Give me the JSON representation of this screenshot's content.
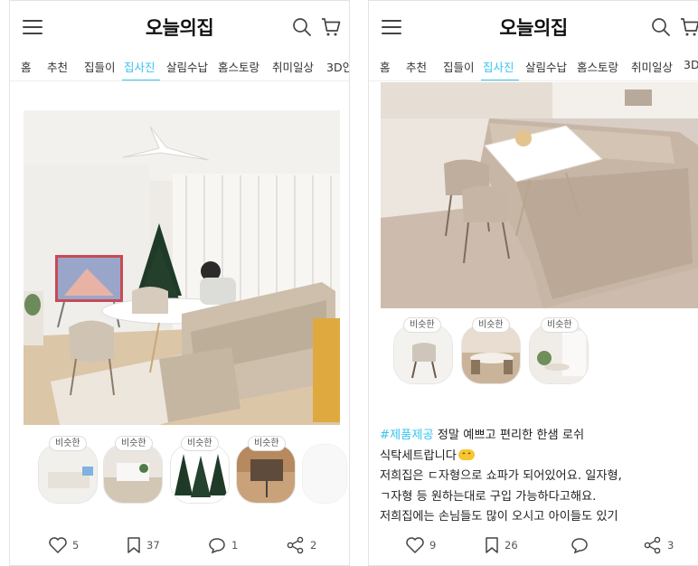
{
  "app": {
    "logo": "오늘의집"
  },
  "tabs": [
    "홈",
    "추천",
    "집들이",
    "집사진",
    "살림수납",
    "홈스토랑",
    "취미일상",
    "3D인"
  ],
  "tabs_right": [
    "홈",
    "추천",
    "집들이",
    "집사진",
    "살림수납",
    "홈스토랑",
    "취미일상",
    "3D"
  ],
  "active_tab": "집사진",
  "similar_badge": "비슷한",
  "left_post": {
    "likes": "5",
    "bookmarks": "37",
    "comments": "1",
    "shares": "2"
  },
  "right_post": {
    "caption_hashtag": "#제품제공",
    "caption_line1_rest": " 정말 예쁘고 편리한 한샘 로쉬",
    "caption_line2": "식탁세트랍니다",
    "caption_line3": "저희집은 ㄷ자형으로 쇼파가 되어있어요. 일자형,",
    "caption_line4": "ㄱ자형 등 원하는대로 구입 가능하다고해요.",
    "caption_line5": "저희집에는 손님들도 많이 오시고 아이들도 있기",
    "likes": "9",
    "bookmarks": "26",
    "comments": "",
    "shares": "3"
  },
  "colors": {
    "accent": "#35c5f0",
    "text": "#222222",
    "icon": "#444444"
  }
}
